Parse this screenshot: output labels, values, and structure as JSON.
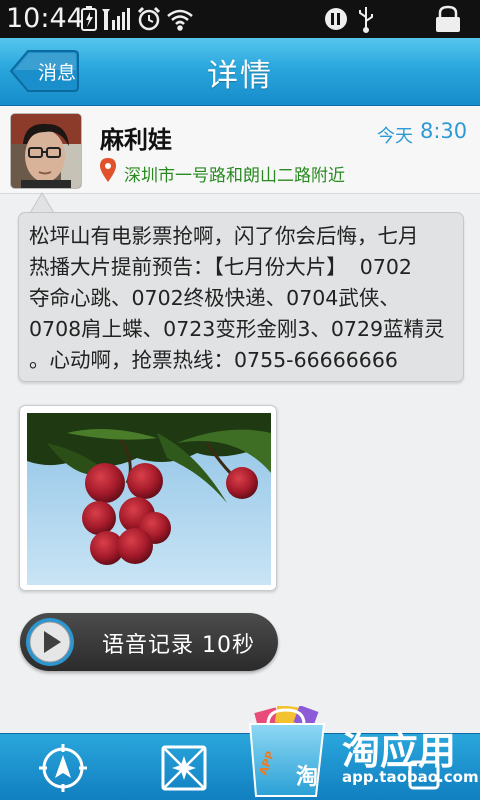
{
  "status_bar": {
    "time": "10:44",
    "icons": [
      "battery-charging-icon",
      "signal-icon",
      "alarm-icon",
      "wifi-icon",
      "media-icon",
      "usb-icon",
      "lock-icon"
    ]
  },
  "title_bar": {
    "back_label": "消息",
    "title": "详情"
  },
  "post": {
    "user_name": "麻利娃",
    "time_label": "今天",
    "time_value": "8:30",
    "location": "深圳市一号路和朗山二路附近",
    "message_lines": [
      "松坪山有电影票抢啊，闪了你会后悔，七月",
      "热播大片提前预告：【七月份大片】  0702",
      "夺命心跳、0702终极快递、0704武侠、",
      "0708肩上蝶、0723变形金刚3、0729蓝精灵",
      "。心动啊，抢票热线：0755-66666666"
    ]
  },
  "voice": {
    "label": "语音记录 10秒"
  },
  "bottom_bar": {
    "icons": [
      "compass-nav-icon",
      "map-icon",
      "app-store-icon"
    ]
  },
  "watermark": {
    "brand": "淘应用",
    "url": "app.taobao.com",
    "bag_text": "APP",
    "bag_char": "淘"
  },
  "colors": {
    "accent": "#2aa6dc",
    "location_text": "#2a8a22",
    "time_text": "#2d9ad6"
  }
}
